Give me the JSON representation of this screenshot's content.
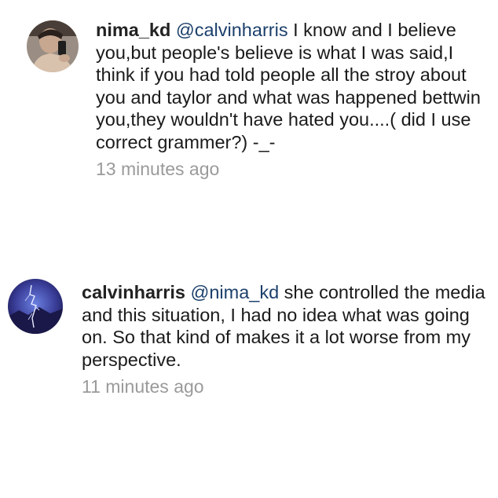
{
  "comments": [
    {
      "username": "nima_kd",
      "mention": "@calvinharris",
      "text": " I know and I believe you,but people's believe is what I was said,I think if you had told people all the stroy about you and taylor and what was happened bettwin you,they wouldn't have hated you....( did I use correct grammer?) -_-",
      "timestamp": "13 minutes ago"
    },
    {
      "username": "calvinharris",
      "mention": "@nima_kd",
      "text": " she controlled the media and this situation, I had no idea what was going on. So that kind of makes it a lot worse from my perspective.",
      "timestamp": "11 minutes ago"
    }
  ],
  "colors": {
    "username": "#222222",
    "mention": "#1b3f6b",
    "timestamp": "#9a9a9a",
    "background": "#ffffff"
  },
  "icons": {
    "avatar_1": "user-photo-avatar",
    "avatar_2": "lightning-sky-avatar"
  }
}
